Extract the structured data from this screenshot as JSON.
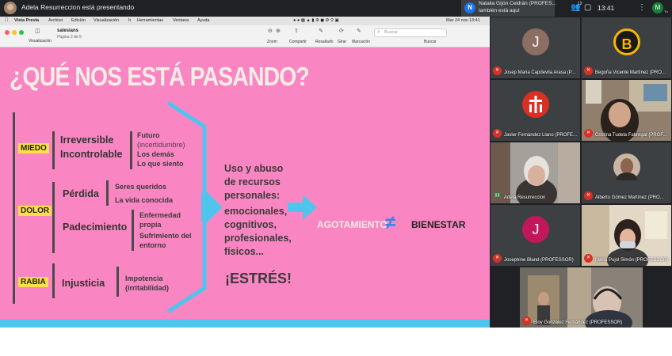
{
  "topbar": {
    "presenting_text": "Adela Resurreccion está presentando",
    "notification": {
      "avatar_letter": "N",
      "line1": "Natalia Gijón Celdrán (PROFES...",
      "line2": "también está aquí"
    },
    "people_count": "12",
    "time": "13:41",
    "user_avatar_letter": "M",
    "user_sub": "Tú"
  },
  "mac_menu": {
    "items": [
      "Vista Previa",
      "Archivo",
      "Edición",
      "Visualización",
      "Ir",
      "Herramientas",
      "Ventana",
      "Ayuda"
    ],
    "status_date": "Mar 24 nov  13:41"
  },
  "preview_toolbar": {
    "visualization_label": "Visualización",
    "doc_title": "salesians",
    "doc_page": "Página 2 de 5",
    "zoom_label": "Zoom",
    "share_label": "Compartir",
    "highlight_label": "Resaltado",
    "rotate_label": "Girar",
    "markup_label": "Marcación",
    "search_label": "Buscar",
    "search_placeholder": "Buscar"
  },
  "slide": {
    "title": "¿QUÉ NOS ESTÁ PASANDO?",
    "emotions": [
      {
        "tag": "MIEDO",
        "main": [
          "Irreversible",
          "Incontrolable"
        ],
        "details": [
          "Futuro",
          "(incertidumbre)",
          "Los demás",
          "Lo que siento"
        ]
      },
      {
        "tag": "DOLOR",
        "mains": [
          "Pérdida",
          "Padecimiento"
        ],
        "details_a": [
          "Seres queridos",
          "La vida conocida"
        ],
        "details_b": [
          "Enfermedad",
          "propia",
          "Sufrimiento del",
          "entorno"
        ]
      },
      {
        "tag": "RABIA",
        "main": [
          "Injusticia"
        ],
        "details": [
          "Impotencia",
          "(irritabilidad)"
        ]
      }
    ],
    "middle_text": [
      "Uso y abuso",
      "de recursos",
      "personales:",
      "emocionales,",
      "cognitivos,",
      "profesionales,",
      "físicos..."
    ],
    "stress": "¡ESTRÉS!",
    "agotamiento": "AGOTAMIENTO",
    "neq_symbol": "≠",
    "bienestar": "BIENESTAR"
  },
  "participants": [
    {
      "name": "Josep Maria Capdevila Arasa (P...",
      "initial": "J",
      "color": "#8d6e63",
      "kind": "initial"
    },
    {
      "name": "Begoña Vicente Martínez (PRO...",
      "initial": "B",
      "color": "#f5b800",
      "kind": "initial"
    },
    {
      "name": "Javier Fernández Llano (PROFE...",
      "initial": "",
      "color": "#d93025",
      "kind": "logo"
    },
    {
      "name": "Cristina Tudela Fabregat (PROF...",
      "initial": "",
      "color": "#8a7a6a",
      "kind": "video"
    },
    {
      "name": "Adela Resurreccion",
      "initial": "",
      "color": "#b9b0a6",
      "kind": "video"
    },
    {
      "name": "Alberto Gómez Martínez (PRO...",
      "initial": "",
      "color": "#5c4a3f",
      "kind": "photo"
    },
    {
      "name": "Josephine Bland (PROFESSOR)",
      "initial": "J",
      "color": "#c2185b",
      "kind": "initial"
    },
    {
      "name": "María Pujol Simón (PROFESSOR)",
      "initial": "",
      "color": "#d6c9b8",
      "kind": "video"
    },
    {
      "name": "Eloy González Fernández (PROFESSOR)",
      "initial": "",
      "color": "#7a6a58",
      "kind": "video"
    }
  ],
  "colors": {
    "slide_bg": "#f986c2",
    "slide_blue": "#4fc4ec",
    "neq_blue": "#3b83e6",
    "tag_yellow": "#fde047",
    "meet_dark": "#202124",
    "tile_bg": "#3c4043",
    "mic_red": "#d93025"
  }
}
